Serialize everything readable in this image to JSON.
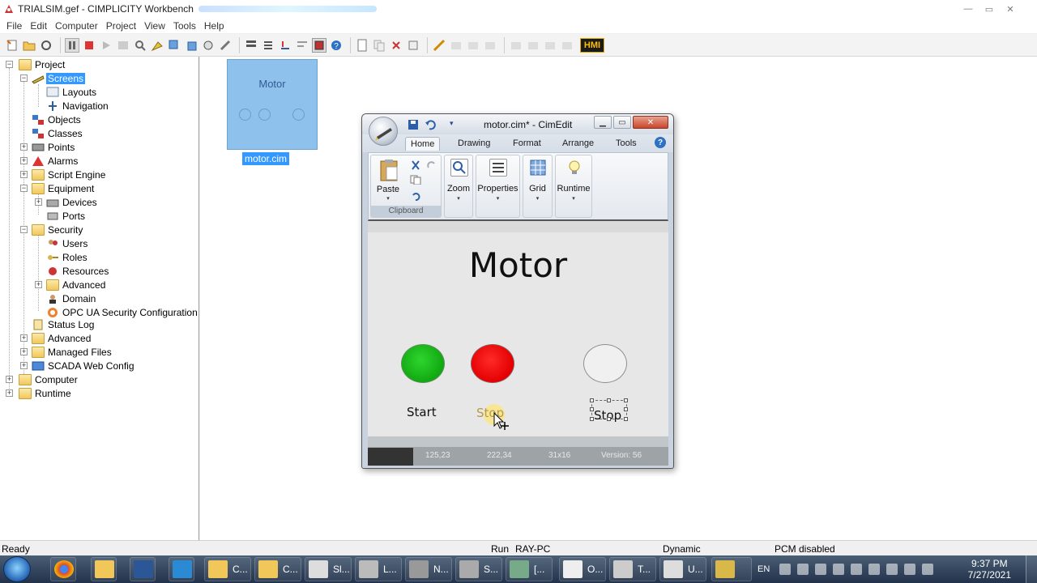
{
  "window": {
    "title": "TRIALSIM.gef - CIMPLICITY Workbench",
    "controls": {
      "minimize": "—",
      "maximize": "▭",
      "close": "✕"
    }
  },
  "menu": [
    "File",
    "Edit",
    "Computer",
    "Project",
    "View",
    "Tools",
    "Help"
  ],
  "toolbar": {
    "hmi_label": "HMI"
  },
  "tree": {
    "project": "Project",
    "screens": "Screens",
    "layouts": "Layouts",
    "navigation": "Navigation",
    "objects": "Objects",
    "classes": "Classes",
    "points": "Points",
    "alarms": "Alarms",
    "script_engine": "Script Engine",
    "equipment": "Equipment",
    "devices": "Devices",
    "ports": "Ports",
    "security": "Security",
    "users": "Users",
    "roles": "Roles",
    "resources": "Resources",
    "advanced_sec": "Advanced",
    "domain": "Domain",
    "opc_ua": "OPC UA Security Configuration",
    "status_log": "Status Log",
    "advanced": "Advanced",
    "managed_files": "Managed Files",
    "scada_web": "SCADA Web Config",
    "computer": "Computer",
    "runtime": "Runtime"
  },
  "thumbnail": {
    "title": "Motor",
    "label": "motor.cim"
  },
  "cimedit": {
    "title": "motor.cim* - CimEdit",
    "tabs": [
      "Home",
      "Drawing",
      "Format",
      "Arrange",
      "Tools"
    ],
    "help": "?",
    "ribbon": {
      "paste": "Paste",
      "clipboard": "Clipboard",
      "zoom": "Zoom",
      "properties": "Properties",
      "grid": "Grid",
      "runtime": "Runtime"
    },
    "canvas": {
      "title": "Motor",
      "start_label": "Start",
      "stop_label": "Stop",
      "stop_label_2": "Stop"
    },
    "status": {
      "pos": "125,23",
      "pos2": "222,34",
      "size": "31x16",
      "version": "Version: 56"
    }
  },
  "statusbar": {
    "ready": "Ready",
    "run": "Run",
    "pc": "RAY-PC",
    "mode": "Dynamic",
    "pcm": "PCM disabled"
  },
  "taskbar": {
    "items": [
      "C...",
      "C...",
      "Sl...",
      "L...",
      "N...",
      "S...",
      "[...",
      "O...",
      "T...",
      "U..."
    ],
    "lang": "EN",
    "time": "9:37 PM",
    "date": "7/27/2021"
  },
  "colors": {
    "selection": "#3399ff",
    "lamp_green": "#11a811",
    "lamp_red": "#e40000",
    "thumb_bg": "#8ec1ec"
  }
}
